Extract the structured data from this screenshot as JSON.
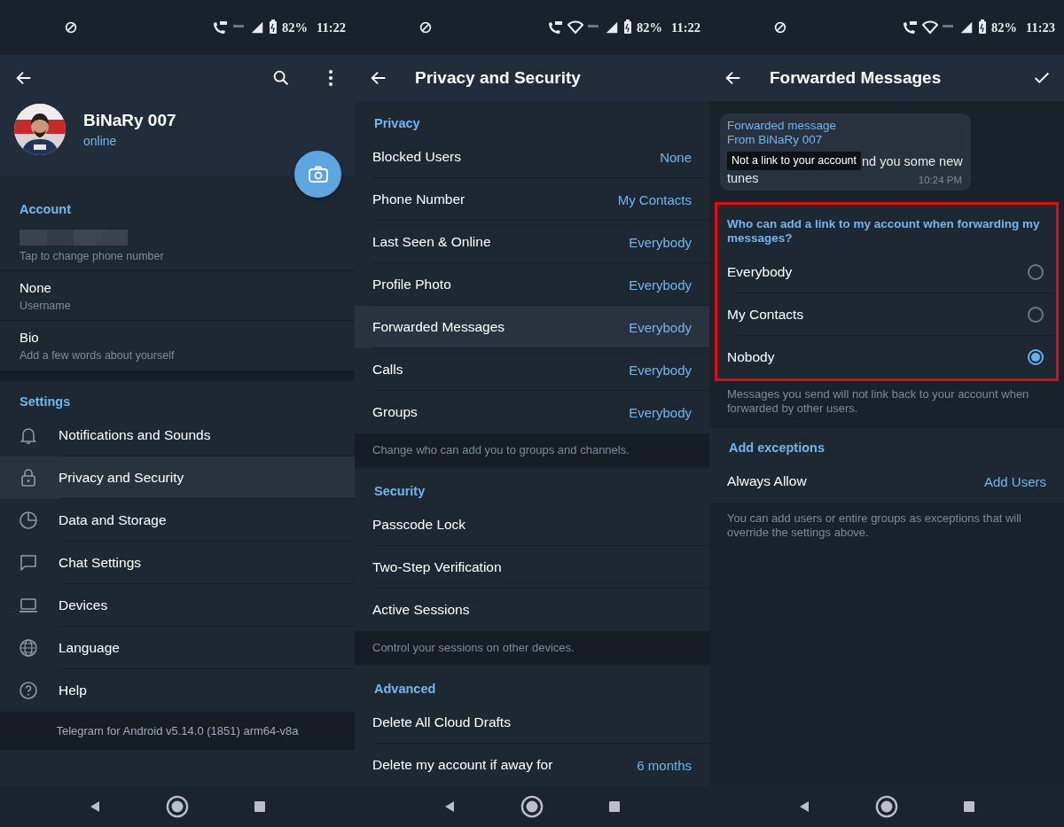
{
  "profile_screen": {
    "status_bar": {
      "wifi": false,
      "battery": "82%",
      "time": "11:22"
    },
    "profile": {
      "name": "BiNaRy 007",
      "status": "online"
    },
    "account": {
      "header": "Account",
      "rows": [
        {
          "kind": "redacted",
          "subtitle": "Tap to change phone number"
        },
        {
          "kind": "text",
          "title": "None",
          "subtitle": "Username"
        },
        {
          "kind": "text",
          "title": "Bio",
          "subtitle": "Add a few words about yourself"
        }
      ]
    },
    "settings": {
      "header": "Settings",
      "items": [
        {
          "label": "Notifications and Sounds",
          "selected": false
        },
        {
          "label": "Privacy and Security",
          "selected": true
        },
        {
          "label": "Data and Storage",
          "selected": false
        },
        {
          "label": "Chat Settings",
          "selected": false
        },
        {
          "label": "Devices",
          "selected": false
        },
        {
          "label": "Language",
          "selected": false
        },
        {
          "label": "Help",
          "selected": false
        }
      ]
    },
    "footer": "Telegram for Android v5.14.0 (1851) arm64-v8a"
  },
  "privacy_screen": {
    "status_bar": {
      "wifi": true,
      "battery": "82%",
      "time": "11:22"
    },
    "title": "Privacy and Security",
    "sections": [
      {
        "header": "Privacy",
        "rows": [
          {
            "label": "Blocked Users",
            "value": "None",
            "selected": false
          },
          {
            "label": "Phone Number",
            "value": "My Contacts",
            "selected": false
          },
          {
            "label": "Last Seen & Online",
            "value": "Everybody",
            "selected": false
          },
          {
            "label": "Profile Photo",
            "value": "Everybody",
            "selected": false
          },
          {
            "label": "Forwarded Messages",
            "value": "Everybody",
            "selected": true
          },
          {
            "label": "Calls",
            "value": "Everybody",
            "selected": false
          },
          {
            "label": "Groups",
            "value": "Everybody",
            "selected": false
          }
        ],
        "note": "Change who can add you to groups and channels."
      },
      {
        "header": "Security",
        "rows": [
          {
            "label": "Passcode Lock",
            "selected": false
          },
          {
            "label": "Two-Step Verification",
            "selected": false
          },
          {
            "label": "Active Sessions",
            "selected": false
          }
        ],
        "note": "Control your sessions on other devices."
      },
      {
        "header": "Advanced",
        "rows": [
          {
            "label": "Delete All Cloud Drafts",
            "selected": false
          },
          {
            "label": "Delete my account if away for",
            "value": "6 months",
            "selected": false
          }
        ]
      }
    ]
  },
  "forwarded_screen": {
    "status_bar": {
      "wifi": true,
      "battery": "82%",
      "time": "11:23"
    },
    "title": "Forwarded Messages",
    "message": {
      "forward_label": "Forwarded message",
      "from": "From BiNaRy 007",
      "lines": [
        "nd you some new",
        "tunes"
      ],
      "time": "10:24 PM",
      "tooltip": "Not a link to your account"
    },
    "question": {
      "header": "Who can add a link to my account when forwarding my messages?",
      "options": [
        {
          "label": "Everybody",
          "selected": false
        },
        {
          "label": "My Contacts",
          "selected": false
        },
        {
          "label": "Nobody",
          "selected": true
        }
      ]
    },
    "note": "Messages you send will not link back to your account when forwarded by other users.",
    "exceptions": {
      "header": "Add exceptions",
      "rows": [
        {
          "label": "Always Allow",
          "value": "Add Users"
        }
      ]
    },
    "exceptions_note": "You can add users or entire groups as exceptions that will override the settings above."
  }
}
